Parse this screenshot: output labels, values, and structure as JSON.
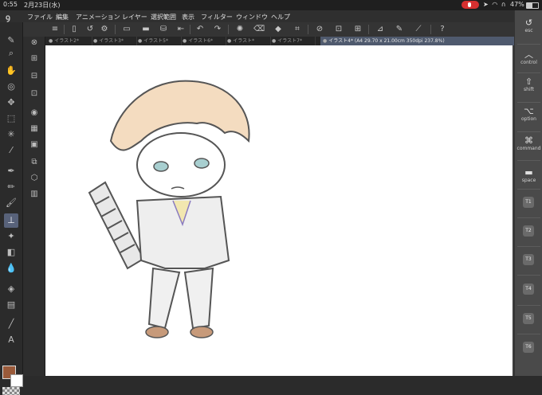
{
  "status_bar": {
    "time": "0:55",
    "date": "2月23日(水)",
    "battery": "47%",
    "battery_level": 0.47,
    "icons": [
      "record-icon",
      "location-icon",
      "wifi-icon",
      "headphones-icon"
    ]
  },
  "menu": {
    "items": [
      "ファイル",
      "編集",
      "アニメーション",
      "レイヤー",
      "選択範囲",
      "表示",
      "フィルター",
      "ウィンドウ",
      "ヘルプ"
    ]
  },
  "tabs": [
    {
      "label": "イラスト2*",
      "active": false
    },
    {
      "label": "イラスト3*",
      "active": false
    },
    {
      "label": "イラスト5*",
      "active": false
    },
    {
      "label": "イラスト6*",
      "active": false
    },
    {
      "label": "イラスト*",
      "active": false
    },
    {
      "label": "イラスト7*",
      "active": false
    },
    {
      "label": "イラスト4* (A4 29.70 x 21.00cm 350dpi 237.8%)",
      "active": true
    }
  ],
  "edge_keys": {
    "esc": "esc",
    "control": "control",
    "shift": "shift",
    "option": "option",
    "command": "command",
    "space": "space",
    "t_keys": [
      "T1",
      "T2",
      "T3",
      "T4",
      "T5",
      "T6"
    ]
  },
  "colors": {
    "main_color": "#9a5a3a",
    "sub_color": "#ffffff",
    "active_tab": "#4f5a6e",
    "record_indicator": "#d63030"
  }
}
